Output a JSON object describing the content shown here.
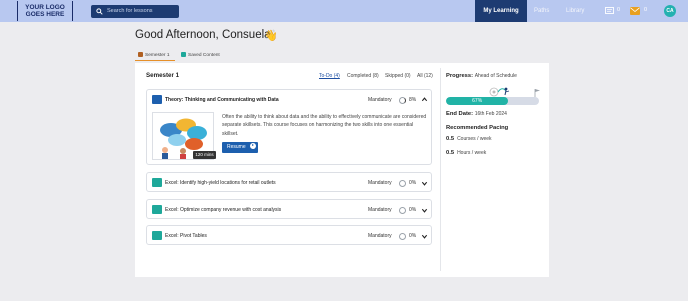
{
  "header": {
    "logo_text": "YOUR LOGO GOES HERE",
    "search_placeholder": "Search for lessons",
    "nav": {
      "my_learning": "My Learning",
      "paths": "Paths",
      "library": "Library"
    },
    "messages_count": "0",
    "notifications_count": "0",
    "avatar_initials": "CA",
    "colors": {
      "bar": "#b8c8f0",
      "active": "#1d3b72",
      "avatar": "#23b1b0"
    }
  },
  "greeting": "Good Afternoon, Consuela",
  "greeting_emoji": "👋",
  "tabs": [
    {
      "label": "Semester 1",
      "active": true
    },
    {
      "label": "Saved Content",
      "active": false
    }
  ],
  "semester": {
    "title": "Semester 1",
    "filters": [
      {
        "label": "To-Do (4)",
        "active": true
      },
      {
        "label": "Completed (8)",
        "active": false
      },
      {
        "label": "Skipped (0)",
        "active": false
      },
      {
        "label": "All (12)",
        "active": false
      }
    ]
  },
  "courses": [
    {
      "title": "Theory: Thinking and Communicating with Data",
      "status": "Mandatory",
      "progress": "8%",
      "progress_value": 0.08,
      "expanded": true,
      "icon": "book-icon",
      "duration": "120 mins",
      "description": "Often the ability to think about data and the ability to effectively communicate are considered separate skillsets. This course focuses on harmonizing the two skills into one essential skillset.",
      "button": "Resume"
    },
    {
      "title": "Excel: Identify high-yield locations for retail outlets",
      "status": "Mandatory",
      "progress": "0%",
      "progress_value": 0,
      "expanded": false,
      "icon": "percent-icon"
    },
    {
      "title": "Excel: Optimize company revenue with cost analysis",
      "status": "Mandatory",
      "progress": "0%",
      "progress_value": 0,
      "expanded": false,
      "icon": "percent-icon"
    },
    {
      "title": "Excel: Pivot Tables",
      "status": "Mandatory",
      "progress": "0%",
      "progress_value": 0,
      "expanded": false,
      "icon": "book-icon"
    }
  ],
  "sidebar": {
    "progress_label": "Progress:",
    "progress_status": "Ahead of Schedule",
    "progress_pct": "67%",
    "progress_value": 0.67,
    "end_date_label": "End Date:",
    "end_date": "16th Feb 2024",
    "pacing_title": "Recommended Pacing",
    "pacing": [
      {
        "value": "0.5",
        "unit": "Courses / week"
      },
      {
        "value": "0.5",
        "unit": "Hours / week"
      }
    ]
  }
}
